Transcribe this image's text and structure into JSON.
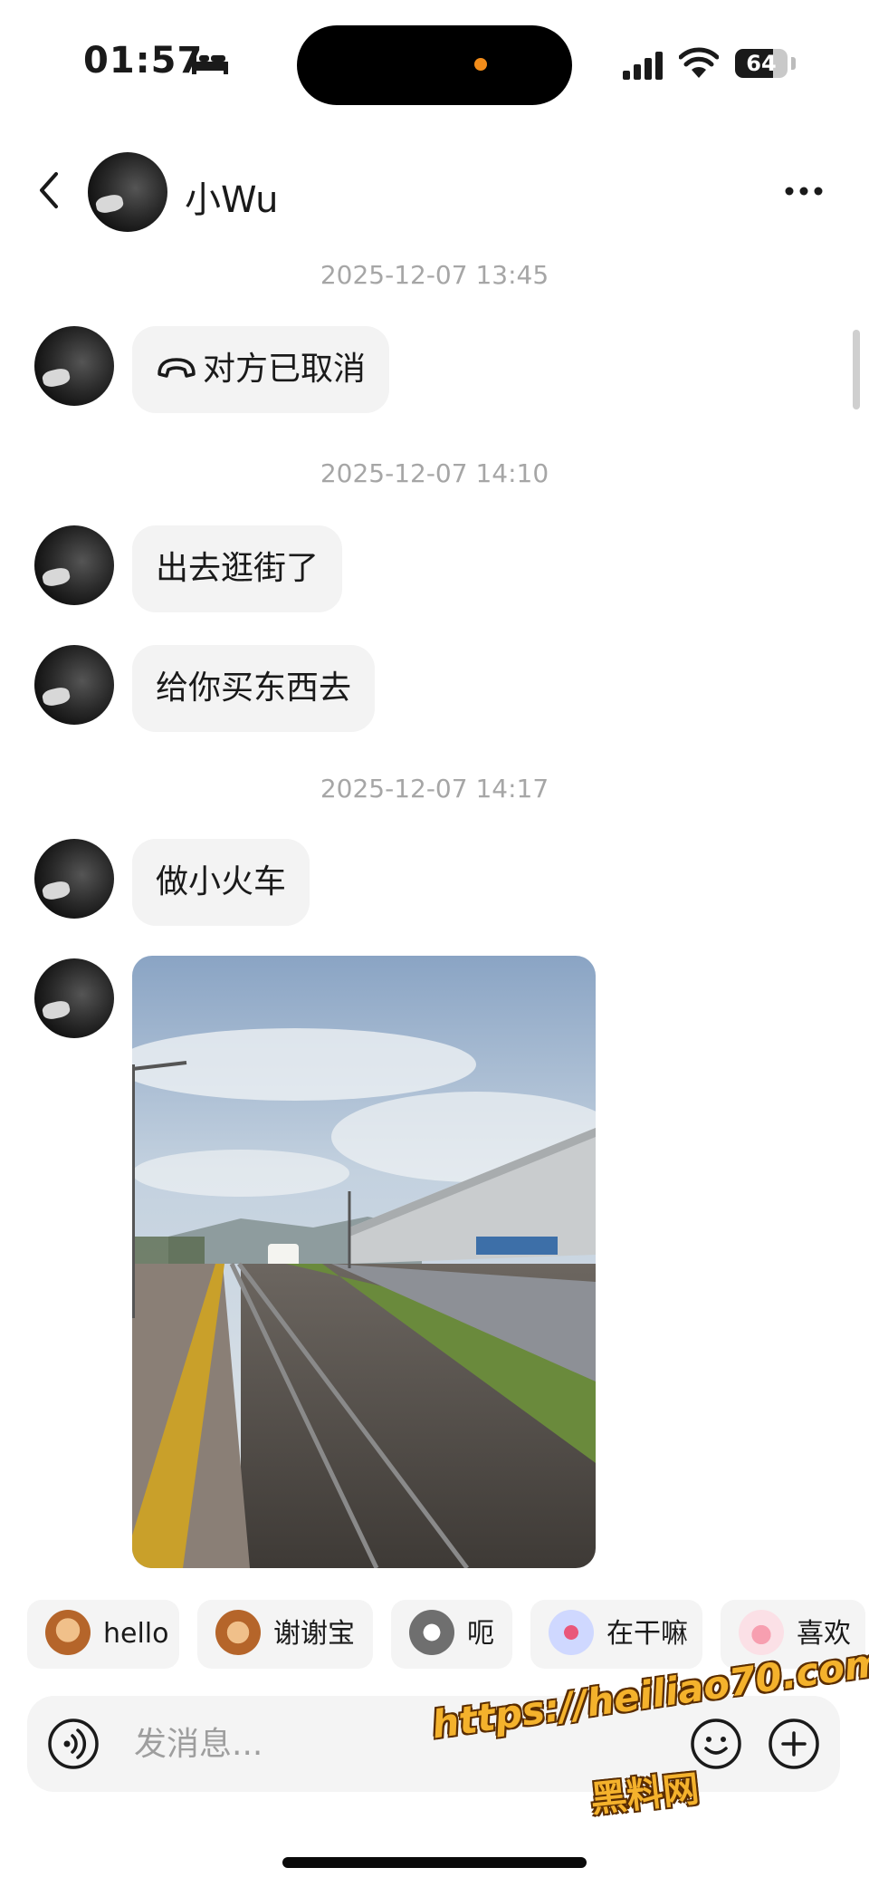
{
  "status_bar": {
    "time": "01:57",
    "battery": "64"
  },
  "header": {
    "contact_name": "小Wu"
  },
  "timestamps": [
    "2025-12-07 13:45",
    "2025-12-07 14:10",
    "2025-12-07 14:17"
  ],
  "messages": [
    {
      "text": "对方已取消",
      "type": "call"
    },
    {
      "text": "出去逛街了",
      "type": "text"
    },
    {
      "text": "给你买东西去",
      "type": "text"
    },
    {
      "text": "做小火车",
      "type": "text"
    },
    {
      "type": "image"
    }
  ],
  "quick_replies": [
    "hello",
    "谢谢宝",
    "呃",
    "在干嘛",
    "喜欢"
  ],
  "input": {
    "placeholder": "发消息..."
  },
  "watermark": {
    "url": "https://heiliao70.com",
    "name": "黑料网"
  },
  "icons": [
    "bed-icon",
    "signal-icon",
    "wifi-icon",
    "back-icon",
    "more-icon",
    "call-icon",
    "voice-icon",
    "emoji-icon",
    "plus-icon"
  ]
}
